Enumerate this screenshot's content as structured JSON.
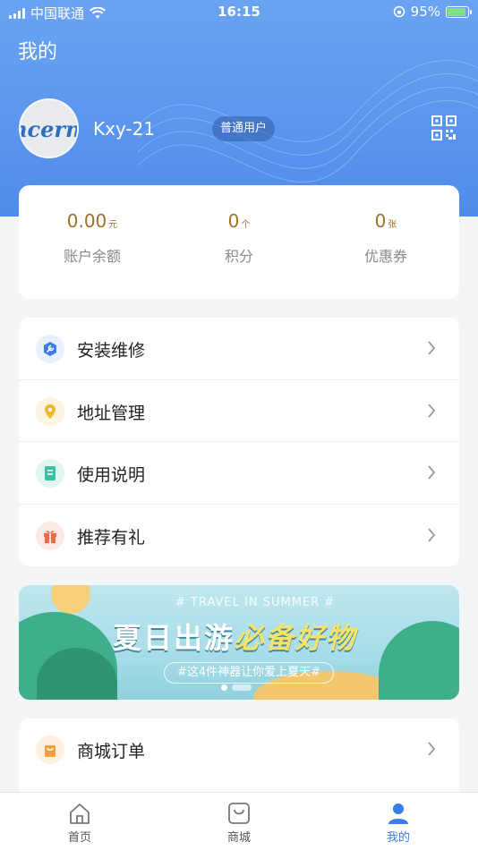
{
  "status_bar": {
    "carrier": "中国联通",
    "time": "16:15",
    "battery": "95%"
  },
  "header": {
    "title": "我的"
  },
  "profile": {
    "username": "Kxy-21",
    "badge": "普通用户",
    "avatar_text": "ncern"
  },
  "stats": [
    {
      "value": "0.00",
      "unit": "元",
      "label": "账户余额"
    },
    {
      "value": "0",
      "unit": "个",
      "label": "积分"
    },
    {
      "value": "0",
      "unit": "张",
      "label": "优惠券"
    }
  ],
  "menu": [
    {
      "label": "安装维修",
      "icon": "wrench-icon",
      "color": "#3a7de8",
      "bg": "#e8f0fd"
    },
    {
      "label": "地址管理",
      "icon": "location-pin-icon",
      "color": "#f0b731",
      "bg": "#fdf4df"
    },
    {
      "label": "使用说明",
      "icon": "book-icon",
      "color": "#3cc3a6",
      "bg": "#e0f6f1"
    },
    {
      "label": "推荐有礼",
      "icon": "gift-icon",
      "color": "#ee6b4a",
      "bg": "#fde9e3"
    }
  ],
  "banner": {
    "subtitle_en": "# TRAVEL IN SUMMER #",
    "headline_main": "夏日出游",
    "headline_accent": "必备好物",
    "tagline": "#这4件神器让你爱上夏天#"
  },
  "menu2": [
    {
      "label": "商城订单",
      "icon": "shopping-bag-icon",
      "color": "#f0a040",
      "bg": "#fdf0df"
    }
  ],
  "tabbar": [
    {
      "label": "首页",
      "icon": "home-icon"
    },
    {
      "label": "商城",
      "icon": "shop-icon"
    },
    {
      "label": "我的",
      "icon": "user-icon",
      "active": true
    }
  ],
  "colors": {
    "primary": "#3a7de8",
    "amount": "#a1702a"
  }
}
